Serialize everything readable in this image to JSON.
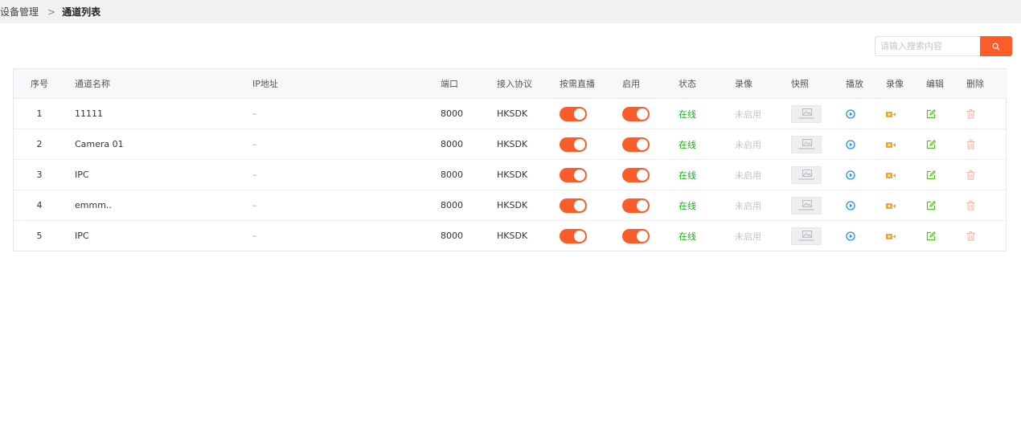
{
  "breadcrumb": {
    "parent": "设备管理",
    "separator": ">",
    "current": "通道列表"
  },
  "search": {
    "placeholder": "请输入搜索内容",
    "value": ""
  },
  "colors": {
    "accent": "#fc5b2a",
    "online": "#1aad19",
    "play": "#1890ff",
    "record": "#f5a623",
    "edit": "#52c41a",
    "delete": "#f5b7b1"
  },
  "table": {
    "headers": {
      "index": "序号",
      "name": "通道名称",
      "ip": "IP地址",
      "port": "端口",
      "protocol": "接入协议",
      "ondemand": "按需直播",
      "enabled": "启用",
      "status": "状态",
      "recording": "录像",
      "snapshot": "快照",
      "play": "播放",
      "record": "录像",
      "edit": "编辑",
      "delete": "删除"
    },
    "rows": [
      {
        "index": "1",
        "name": "11111",
        "ip": "–",
        "port": "8000",
        "protocol": "HKSDK",
        "ondemand": true,
        "enabled": true,
        "status": "在线",
        "recording": "未启用"
      },
      {
        "index": "2",
        "name": "Camera 01",
        "ip": "–",
        "port": "8000",
        "protocol": "HKSDK",
        "ondemand": true,
        "enabled": true,
        "status": "在线",
        "recording": "未启用"
      },
      {
        "index": "3",
        "name": "IPC",
        "ip": "–",
        "port": "8000",
        "protocol": "HKSDK",
        "ondemand": true,
        "enabled": true,
        "status": "在线",
        "recording": "未启用"
      },
      {
        "index": "4",
        "name": "emmm..",
        "ip": "–",
        "port": "8000",
        "protocol": "HKSDK",
        "ondemand": true,
        "enabled": true,
        "status": "在线",
        "recording": "未启用"
      },
      {
        "index": "5",
        "name": "IPC",
        "ip": "–",
        "port": "8000",
        "protocol": "HKSDK",
        "ondemand": true,
        "enabled": true,
        "status": "在线",
        "recording": "未启用"
      }
    ]
  }
}
